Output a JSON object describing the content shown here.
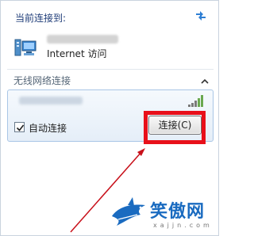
{
  "popup": {
    "current_label": "当前连接到:",
    "network_status": "Internet 访问",
    "section_label": "无线网络连接"
  },
  "wifi": {
    "auto_connect_label": "自动连接",
    "auto_connect_checked": true,
    "connect_button": "连接(C)"
  },
  "watermark": {
    "brand": "笑傲网",
    "url": "xajjn.com"
  },
  "colors": {
    "highlight": "#e8101a",
    "arrow": "#c8101a",
    "accent": "#1a6bc0"
  },
  "icons": {
    "refresh": "refresh-icon",
    "network": "network-icon",
    "collapse": "chevron-up-icon",
    "signal": "signal-strength-icon",
    "checkbox": "checkmark-icon"
  }
}
